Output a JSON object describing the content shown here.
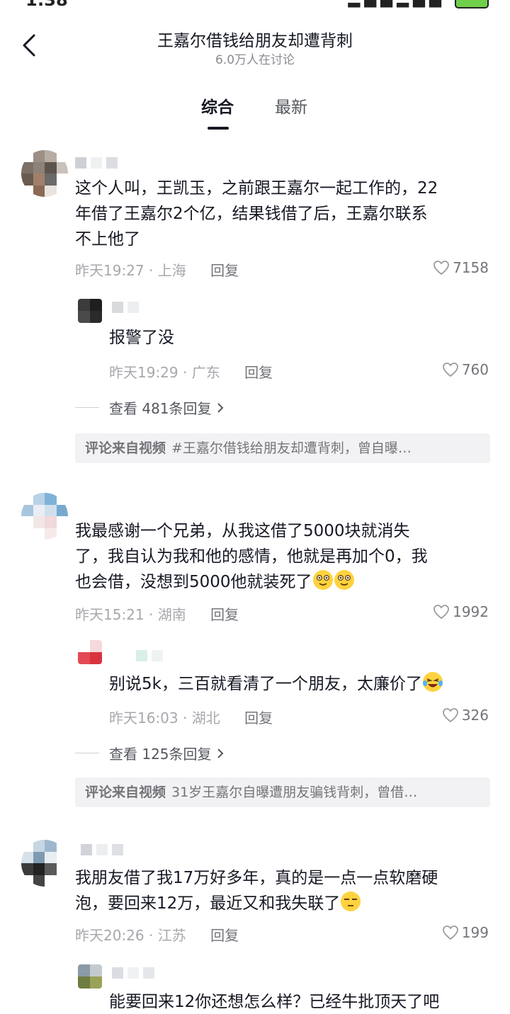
{
  "status": {
    "time": "1:38"
  },
  "header": {
    "title": "王嘉尔借钱给朋友却遭背刺",
    "subtitle": "6.0万人在讨论",
    "tabs": [
      "综合",
      "最新"
    ]
  },
  "comments": [
    {
      "text": "这个人叫，王凯玉，之前跟王嘉尔一起工作的，22年借了王嘉尔2个亿，结果钱借了后，王嘉尔联系不上他了",
      "lines": [
        "这个人叫，王凯玉，之前跟王嘉尔一起工作的，22",
        "年借了王嘉尔2个亿，结果钱借了后，王嘉尔联系",
        "不上他了"
      ],
      "time_location": "昨天19:27 · 上海",
      "reply_label": "回复",
      "likes": "7158",
      "reply": {
        "text": "报警了没",
        "time_location": "昨天19:29 · 广东",
        "reply_label": "回复",
        "likes": "760"
      },
      "more_replies": "查看 481条回复",
      "source": {
        "label": "评论来自视频",
        "text": "#王嘉尔借钱给朋友却遭背刺，曾自曝…"
      }
    },
    {
      "lines": [
        "我最感谢一个兄弟，从我这借了5000块就消失",
        "了，我自认为我和他的感情，他就是再加个0，我",
        "也会借，没想到5000他就装死了"
      ],
      "time_location": "昨天15:21 · 湖南",
      "reply_label": "回复",
      "likes": "1992",
      "reply": {
        "text": "别说5k，三百就看清了一个朋友，太廉价了",
        "time_location": "昨天16:03 · 湖北",
        "reply_label": "回复",
        "likes": "326"
      },
      "more_replies": "查看 125条回复",
      "source": {
        "label": "评论来自视频",
        "text": "31岁王嘉尔自曝遭朋友骗钱背刺，曾借…"
      }
    },
    {
      "lines": [
        "我朋友借了我17万好多年，真的是一点一点软磨硬",
        "泡，要回来12万，最近又和我失联了"
      ],
      "time_location": "昨天20:26 · 江苏",
      "reply_label": "回复",
      "likes": "199",
      "reply": {
        "text": "能要回来12你还想怎么样？已经牛批顶天了吧"
      }
    }
  ],
  "colors": {
    "text": "#161823",
    "muted": "#a7a8ad",
    "source_bg": "#f2f2f4"
  }
}
